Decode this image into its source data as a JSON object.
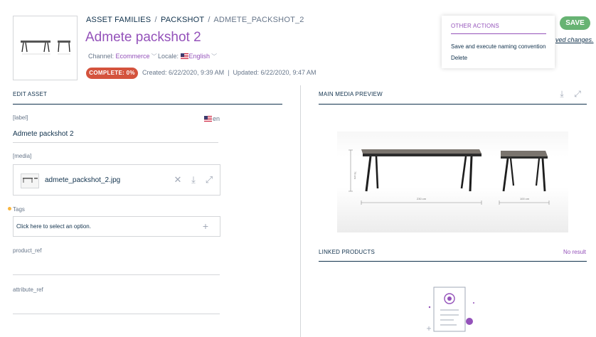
{
  "breadcrumb": {
    "family": "ASSET FAMILIES",
    "packshot": "PACKSHOT",
    "current": "ADMETE_PACKSHOT_2",
    "separator": "/"
  },
  "asset": {
    "title": "Admete packshot 2",
    "channel_label": "Channel:",
    "channel_value": "Ecommerce",
    "locale_label": "Locale:",
    "locale_value": "English",
    "completeness": "COMPLETE: 0%",
    "created": "Created: 6/22/2020, 9:39 AM",
    "updated": "Updated: 6/22/2020, 9:47 AM",
    "meta_separator": "|"
  },
  "actions": {
    "save_label": "SAVE",
    "unsaved_text": "ved changes.",
    "menu_title": "OTHER ACTIONS",
    "menu_items": [
      "Save and execute naming convention",
      "Delete"
    ]
  },
  "edit": {
    "section_title": "EDIT ASSET",
    "label_field": "[label]",
    "label_locale": "en",
    "label_value": "Admete packshot 2",
    "media_field": "[media]",
    "media_filename": "admete_packshot_2.jpg",
    "tags_field": "Tags",
    "tags_placeholder": "Click here to select an option.",
    "product_ref_field": "product_ref",
    "attribute_ref_field": "attribute_ref"
  },
  "preview": {
    "section_title": "MAIN MEDIA PREVIEW",
    "dim_height": "76 cm",
    "dim_width_long": "230 cm",
    "dim_width_short": "100 cm"
  },
  "linked": {
    "section_title": "LINKED PRODUCTS",
    "status": "No result"
  },
  "colors": {
    "accent": "#9452ba",
    "save": "#67b373",
    "badge_incomplete": "#d4533d",
    "text": "#11324d",
    "required": "#f9b53f"
  },
  "icons": [
    "close-icon",
    "download-icon",
    "fullscreen-icon",
    "plus-icon",
    "chevron-down-icon",
    "flag-us-icon"
  ]
}
